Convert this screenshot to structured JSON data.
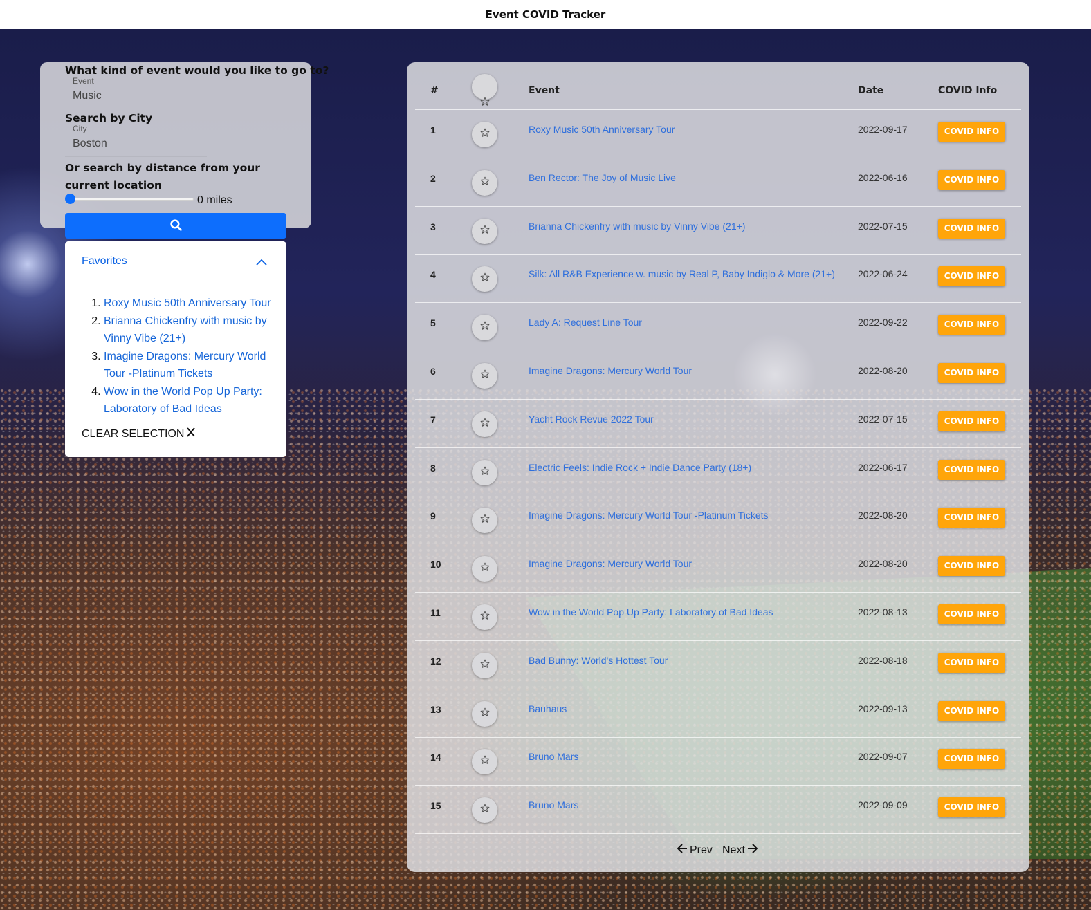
{
  "app": {
    "title": "Event COVID Tracker"
  },
  "search": {
    "event_question": "What kind of event would you like to go to?",
    "event_label": "Event",
    "event_value": "Music",
    "city_question": "Search by City",
    "city_label": "City",
    "city_value": "Boston",
    "distance_question": "Or search by distance from your current location",
    "distance_value": 0,
    "distance_text": "0 miles",
    "search_icon": "search-icon"
  },
  "favorites": {
    "title": "Favorites",
    "items": [
      "Roxy Music 50th Anniversary Tour",
      "Brianna Chickenfry with music by Vinny Vibe (21+)",
      "Imagine Dragons: Mercury World Tour -Platinum Tickets",
      "Wow in the World Pop Up Party: Laboratory of Bad Ideas"
    ],
    "clear_label": "CLEAR SELECTION"
  },
  "table": {
    "headers": {
      "num": "#",
      "event": "Event",
      "date": "Date",
      "covid": "COVID Info"
    },
    "covid_button_label": "COVID INFO",
    "rows": [
      {
        "num": "1",
        "event": "Roxy Music 50th Anniversary Tour",
        "date": "2022-09-17"
      },
      {
        "num": "2",
        "event": "Ben Rector: The Joy of Music Live",
        "date": "2022-06-16"
      },
      {
        "num": "3",
        "event": "Brianna Chickenfry with music by Vinny Vibe (21+)",
        "date": "2022-07-15"
      },
      {
        "num": "4",
        "event": "Silk: All R&B Experience w. music by Real P, Baby Indiglo & More (21+)",
        "date": "2022-06-24"
      },
      {
        "num": "5",
        "event": "Lady A: Request Line Tour",
        "date": "2022-09-22"
      },
      {
        "num": "6",
        "event": "Imagine Dragons: Mercury World Tour",
        "date": "2022-08-20"
      },
      {
        "num": "7",
        "event": "Yacht Rock Revue 2022 Tour",
        "date": "2022-07-15"
      },
      {
        "num": "8",
        "event": "Electric Feels: Indie Rock + Indie Dance Party (18+)",
        "date": "2022-06-17"
      },
      {
        "num": "9",
        "event": "Imagine Dragons: Mercury World Tour -Platinum Tickets",
        "date": "2022-08-20"
      },
      {
        "num": "10",
        "event": "Imagine Dragons: Mercury World Tour",
        "date": "2022-08-20"
      },
      {
        "num": "11",
        "event": "Wow in the World Pop Up Party: Laboratory of Bad Ideas",
        "date": "2022-08-13"
      },
      {
        "num": "12",
        "event": "Bad Bunny: World's Hottest Tour",
        "date": "2022-08-18"
      },
      {
        "num": "13",
        "event": "Bauhaus",
        "date": "2022-09-13"
      },
      {
        "num": "14",
        "event": "Bruno Mars",
        "date": "2022-09-07"
      },
      {
        "num": "15",
        "event": "Bruno Mars",
        "date": "2022-09-09"
      }
    ]
  },
  "pagination": {
    "prev_label": "Prev",
    "next_label": "Next"
  },
  "colors": {
    "accent": "#0d6efd",
    "covid_button": "#ffa50a",
    "link": "#2f6fdc"
  }
}
